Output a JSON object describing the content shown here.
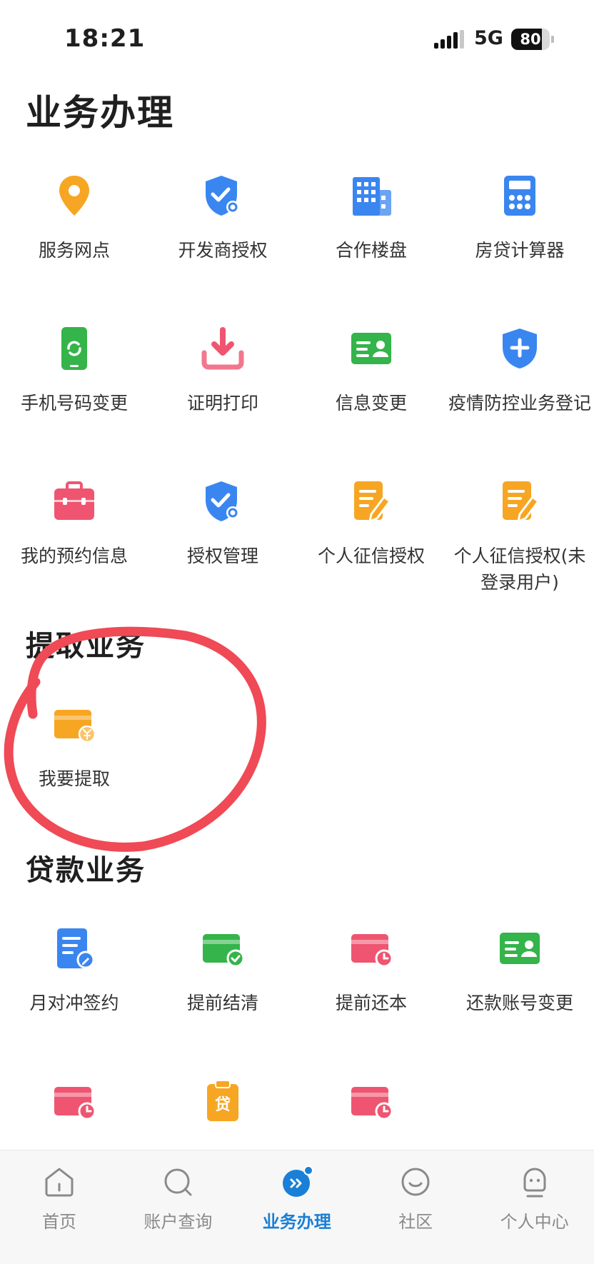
{
  "status": {
    "time": "18:21",
    "network": "5G",
    "battery": "80",
    "battery_level": 0.8
  },
  "page": {
    "title": "业务办理"
  },
  "services": [
    {
      "label": "服务网点",
      "icon": "location-pin-icon"
    },
    {
      "label": "开发商授权",
      "icon": "shield-check-icon"
    },
    {
      "label": "合作楼盘",
      "icon": "building-icon"
    },
    {
      "label": "房贷计算器",
      "icon": "calculator-icon"
    },
    {
      "label": "手机号码变更",
      "icon": "phone-icon"
    },
    {
      "label": "证明打印",
      "icon": "download-icon"
    },
    {
      "label": "信息变更",
      "icon": "id-card-icon"
    },
    {
      "label": "疫情防控业务登记",
      "icon": "shield-plus-icon"
    },
    {
      "label": "我的预约信息",
      "icon": "briefcase-icon"
    },
    {
      "label": "授权管理",
      "icon": "shield-check-icon"
    },
    {
      "label": "个人征信授权",
      "icon": "document-edit-icon"
    },
    {
      "label": "个人征信授权(未登录用户)",
      "icon": "document-edit-icon"
    }
  ],
  "withdraw": {
    "title": "提取业务",
    "items": [
      {
        "label": "我要提取",
        "icon": "card-yuan-icon"
      }
    ]
  },
  "loan": {
    "title": "贷款业务",
    "items": [
      {
        "label": "月对冲签约",
        "icon": "document-pen-icon"
      },
      {
        "label": "提前结清",
        "icon": "card-check-icon"
      },
      {
        "label": "提前还本",
        "icon": "card-clock-icon"
      },
      {
        "label": "还款账号变更",
        "icon": "id-card-icon"
      },
      {
        "label": "",
        "icon": "card-clock-icon"
      },
      {
        "label": "",
        "icon": "clipboard-loan-icon",
        "glyph": "贷"
      },
      {
        "label": "",
        "icon": "card-clock-icon"
      }
    ]
  },
  "tabs": [
    {
      "label": "首页",
      "icon": "home-icon"
    },
    {
      "label": "账户查询",
      "icon": "search-chat-icon"
    },
    {
      "label": "业务办理",
      "icon": "business-icon",
      "active": true
    },
    {
      "label": "社区",
      "icon": "community-icon"
    },
    {
      "label": "个人中心",
      "icon": "profile-icon"
    }
  ],
  "colors": {
    "accent": "#1a7fd6",
    "orange": "#f6a623",
    "blue": "#3a86f0",
    "green": "#34b44a",
    "red": "#ef5570",
    "annotation": "#ef4a55"
  }
}
